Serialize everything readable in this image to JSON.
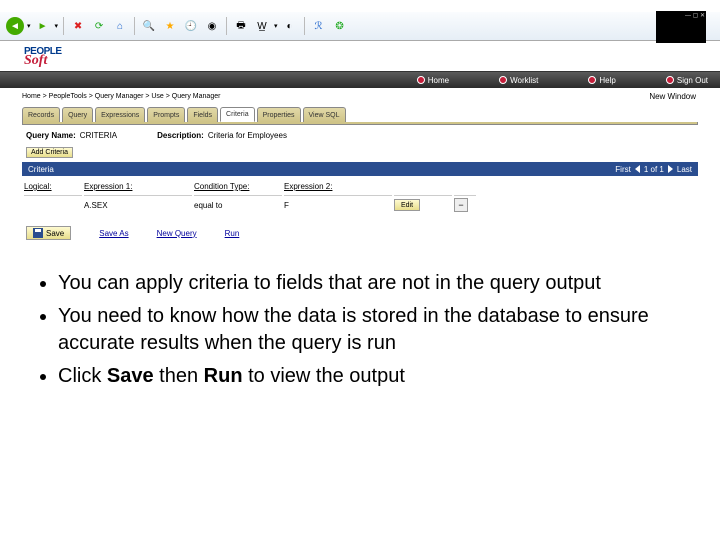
{
  "browser": {
    "toolbar_icons": [
      "back",
      "forward",
      "stop",
      "refresh",
      "home",
      "search",
      "favorites",
      "history",
      "mail",
      "print",
      "font-size",
      "encoding",
      "research",
      "messenger",
      "extras"
    ]
  },
  "logo": {
    "line1": "PEOPLE",
    "line2": "Soft"
  },
  "top_nav": [
    {
      "label": "Home"
    },
    {
      "label": "Worklist"
    },
    {
      "label": "Help"
    },
    {
      "label": "Sign Out"
    }
  ],
  "breadcrumb": "Home > PeopleTools > Query Manager > Use > Query Manager",
  "new_window": "New Window",
  "tabs": [
    {
      "label": "Records"
    },
    {
      "label": "Query"
    },
    {
      "label": "Expressions"
    },
    {
      "label": "Prompts"
    },
    {
      "label": "Fields"
    },
    {
      "label": "Criteria",
      "active": true
    },
    {
      "label": "Properties"
    },
    {
      "label": "View SQL"
    }
  ],
  "query": {
    "name_label": "Query Name:",
    "name": "CRITERIA",
    "desc_label": "Description:",
    "desc": "Criteria for Employees"
  },
  "add_criteria_btn": "Add Criteria",
  "section_title": "Criteria",
  "pager": {
    "first": "First",
    "pos": "1 of 1",
    "last": "Last"
  },
  "columns": [
    "Logical:",
    "Expression 1:",
    "Condition Type:",
    "Expression 2:",
    "",
    ""
  ],
  "row": {
    "logical": "",
    "expr1": "A.SEX",
    "cond": "equal to",
    "expr2": "F",
    "edit": "Edit"
  },
  "actions": {
    "save": "Save",
    "save_as": "Save As",
    "new_query": "New Query",
    "run": "Run"
  },
  "bullets": [
    "You can apply criteria to fields that are not in the query output",
    "You need to know how the data is stored in the database to ensure accurate results when the query is run",
    {
      "pre": "Click ",
      "b1": "Save",
      "mid": " then ",
      "b2": "Run",
      "post": " to view the output"
    }
  ]
}
